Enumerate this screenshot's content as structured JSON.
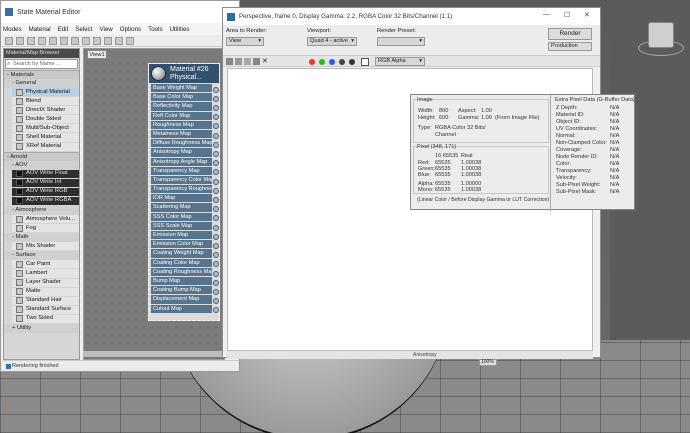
{
  "sme": {
    "title": "State Material Editor",
    "menu": [
      "Modes",
      "Material",
      "Edit",
      "Select",
      "View",
      "Options",
      "Tools",
      "Utilities"
    ],
    "browser_title": "Material/Map Browser",
    "search_placeholder": "Search by Name ...",
    "sections": {
      "materials": "- Materials",
      "general": "- General",
      "arnold": "- Arnold",
      "aov": "- AOV",
      "atmosphere": "- Atmosphere",
      "math": "- Math",
      "surface": "- Surface",
      "utility": "+ Utility"
    },
    "general_items": [
      "Physical Material",
      "Blend",
      "DirectX Shader",
      "Double Sided",
      "Multi/Sub-Object",
      "Shell Material",
      "XRef Material"
    ],
    "aov_items": [
      "AOV Write Float",
      "AOV Write Int",
      "AOV Write RGB",
      "AOV Write RGBA"
    ],
    "atmosphere_items": [
      "Atmosphere Volu...",
      "Fog"
    ],
    "math_items": [
      "Mix Shader"
    ],
    "surface_items": [
      "Car Paint",
      "Lambert",
      "Layer Shader",
      "Matte",
      "Standard Hair",
      "Standard Surface",
      "Two Sided"
    ],
    "view_tab": "View1",
    "node_title": "Material #26\nPhysical...",
    "node_slots": [
      "Base Weight Map",
      "Base Color Map",
      "Reflectivity Map",
      "Refl Color Map",
      "Roughness Map",
      "Metalness Map",
      "Diffuse Roughness Map",
      "Anisotropy Map",
      "Anisotropy Angle Map",
      "Transparency Map",
      "Transparency Color Map",
      "Transparency Roughnes...",
      "IOR Map",
      "Scattering Map",
      "SSS Color Map",
      "SSS Scale Map",
      "Emission Map",
      "Emission Color Map",
      "Coating Weight Map",
      "Coating Color Map",
      "Coating Roughness Map",
      "Bump Map",
      "Coating Bump Map",
      "Displacement Map",
      "Cutout Map"
    ],
    "status": "Rendering finished"
  },
  "rfw": {
    "title": "Perspective, frame 0, Display Gamma: 2.2, RGBA Color 32 Bits/Channel (1:1)",
    "area_label": "Area to Render:",
    "area_value": "View",
    "viewport_label": "Viewport:",
    "viewport_value": "Quad 4 - active",
    "preset_label": "Render Preset:",
    "preset_value": "",
    "render_button": "Render",
    "production_value": "Production",
    "channel_value": "RGB Alpha",
    "zoom_value": "100%",
    "bottom_text": "Anisotropy"
  },
  "pixel_info": {
    "image_header": "Image",
    "width_label": "Width:",
    "width_value": "800",
    "height_label": "Height:",
    "height_value": "600",
    "aspect_label": "Aspect:",
    "aspect_value": "1.00",
    "gamma_label": "Gamma:",
    "gamma_value": "1.00",
    "gamma_note": "(From Image File)",
    "type_label": "Type:",
    "type_value": "RGBA Color 32 Bits/\nChannel",
    "pixel_header": "Pixel (348, 171)",
    "bits_header": "16 65535",
    "real_header": "Real",
    "red_label": "Red:",
    "red_int": "65535",
    "red_real": "1.00038",
    "green_label": "Green:",
    "green_int": "65535",
    "green_real": "1.00038",
    "blue_label": "Blue:",
    "blue_int": "65535",
    "blue_real": "1.00038",
    "alpha_label": "Alpha:",
    "alpha_int": "65535",
    "alpha_real": "1.00000",
    "mono_label": "Mono:",
    "mono_int": "65535",
    "mono_real": "1.00038",
    "linear_note": "(Linear Color / Before Display Gamma or LUT Correction)",
    "extra_header": "Extra Pixel Data (G-Buffer Data)",
    "extra_rows": [
      {
        "label": "Z Depth:",
        "value": "N/A"
      },
      {
        "label": "Material ID:",
        "value": "N/A"
      },
      {
        "label": "Object ID:",
        "value": "N/A"
      },
      {
        "label": "UV Coordinates:",
        "value": "N/A"
      },
      {
        "label": "Normal:",
        "value": "N/A"
      },
      {
        "label": "Non-Clamped Color:",
        "value": "N/A"
      },
      {
        "label": "Coverage:",
        "value": "N/A"
      },
      {
        "label": "Node Render ID:",
        "value": "N/A"
      },
      {
        "label": "Color:",
        "value": "N/A"
      },
      {
        "label": "Transparency:",
        "value": "N/A"
      },
      {
        "label": "Velocity:",
        "value": "N/A"
      },
      {
        "label": "Sub-Pixel Weight:",
        "value": "N/A"
      },
      {
        "label": "Sub-Pixel Mask:",
        "value": "N/A"
      }
    ]
  }
}
